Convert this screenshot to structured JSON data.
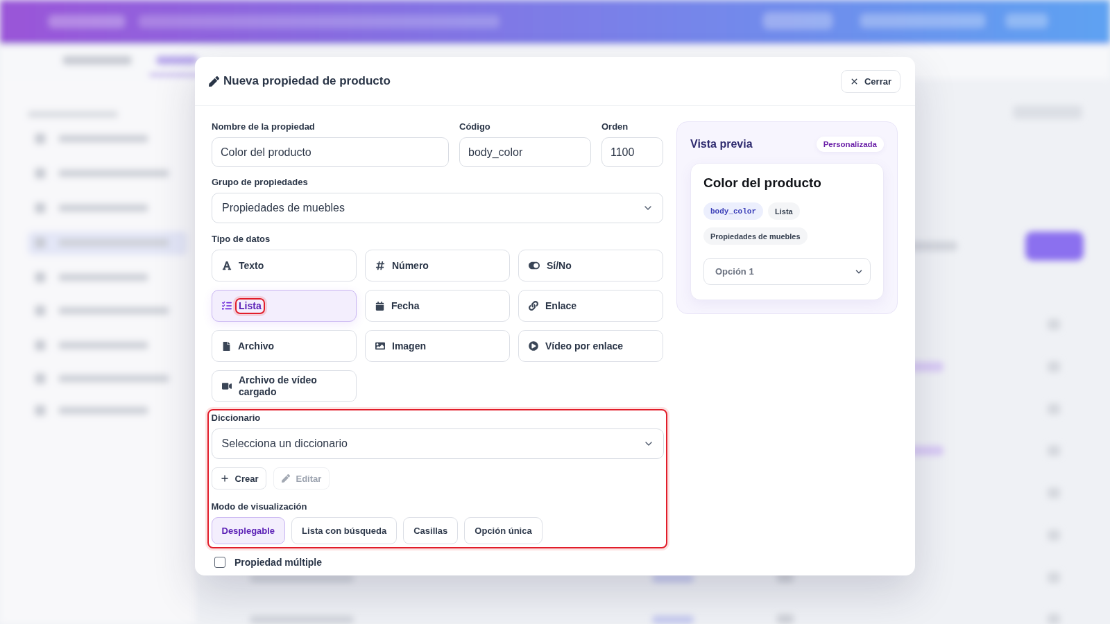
{
  "dialog": {
    "title": "Nueva propiedad de producto",
    "close_label": "Cerrar"
  },
  "fields": {
    "name": {
      "label": "Nombre de la propiedad",
      "value": "Color del producto"
    },
    "code": {
      "label": "Código",
      "value": "body_color"
    },
    "order": {
      "label": "Orden",
      "value": "1100"
    },
    "group": {
      "label": "Grupo de propiedades",
      "value": "Propiedades de muebles"
    }
  },
  "data_type": {
    "label": "Tipo de datos",
    "options": [
      {
        "kind": "text",
        "label": "Texto",
        "selected": false,
        "highlighted": false
      },
      {
        "kind": "number",
        "label": "Número",
        "selected": false,
        "highlighted": false
      },
      {
        "kind": "boolean",
        "label": "Sí/No",
        "selected": false,
        "highlighted": false
      },
      {
        "kind": "list",
        "label": "Lista",
        "selected": true,
        "highlighted": true
      },
      {
        "kind": "date",
        "label": "Fecha",
        "selected": false,
        "highlighted": false
      },
      {
        "kind": "link",
        "label": "Enlace",
        "selected": false,
        "highlighted": false
      },
      {
        "kind": "file",
        "label": "Archivo",
        "selected": false,
        "highlighted": false
      },
      {
        "kind": "image",
        "label": "Imagen",
        "selected": false,
        "highlighted": false
      },
      {
        "kind": "video_link",
        "label": "Vídeo por enlace",
        "selected": false,
        "highlighted": false
      },
      {
        "kind": "video_file",
        "label": "Archivo de vídeo cargado",
        "selected": false,
        "highlighted": false
      }
    ]
  },
  "dictionary": {
    "highlighted": true,
    "label": "Diccionario",
    "placeholder": "Selecciona un diccionario",
    "actions": [
      {
        "kind": "create",
        "label": "Crear",
        "disabled": false
      },
      {
        "kind": "edit",
        "label": "Editar",
        "disabled": true
      }
    ],
    "display_mode": {
      "label": "Modo de visualización",
      "options": [
        {
          "label": "Desplegable",
          "selected": true
        },
        {
          "label": "Lista con búsqueda",
          "selected": false
        },
        {
          "label": "Casillas",
          "selected": false
        },
        {
          "label": "Opción única",
          "selected": false
        }
      ]
    }
  },
  "multiple": {
    "label": "Propiedad múltiple",
    "checked": false
  },
  "preview": {
    "title": "Vista previa",
    "badge": "Personalizada",
    "card": {
      "title": "Color del producto",
      "chips": [
        {
          "kind": "code",
          "label": "body_color"
        },
        {
          "kind": "plain",
          "label": "Lista"
        },
        {
          "kind": "plain",
          "label": "Propiedades de muebles"
        }
      ],
      "select_value": "Opción 1"
    }
  }
}
